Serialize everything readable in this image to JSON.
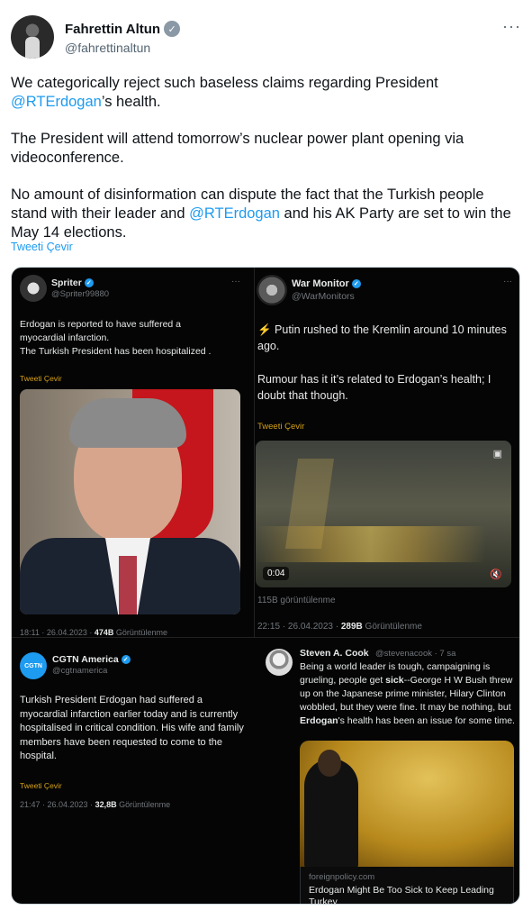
{
  "author": {
    "name": "Fahrettin Altun",
    "handle": "@fahrettinaltun",
    "more": "···"
  },
  "tweet": {
    "p1_a": "We categorically reject such baseless claims regarding President ",
    "p1_mention": "@RTErdogan",
    "p1_b": "’s health.",
    "p2": "The President will attend tomorrow’s nuclear power plant opening via videoconference.",
    "p3_a": "No amount of disinformation can dispute the fact that the Turkish people stand with their leader and ",
    "p3_mention": "@RTErdogan",
    "p3_b": " and his AK Party are set to win the May 14 elections.",
    "translate": "Tweeti Çevir"
  },
  "embedded": {
    "spriter": {
      "name": "Spriter",
      "handle": "@Spriter99880",
      "text": "Erdogan is reported to have suffered a myocardial infarction.\nThe Turkish President has been hospitalized .",
      "translate": "Tweeti Çevir",
      "meta_time": "18:11 · 26.04.2023 · ",
      "meta_views": "474B",
      "meta_label": " Görüntülenme"
    },
    "warmonitor": {
      "name": "War Monitor",
      "handle": "@WarMonitors",
      "text1": "⚡ Putin rushed to the Kremlin around 10 minutes ago.",
      "text2": "Rumour has it it’s related to Erdogan’s health; I doubt that though.",
      "translate": "Tweeti Çevir",
      "video_time": "0:04",
      "views": "115B görüntülenme",
      "meta_time": "22:15 · 26.04.2023 · ",
      "meta_views": "289B",
      "meta_label": " Görüntülenme"
    },
    "cgtn": {
      "name": "CGTN America",
      "handle": "@cgtnamerica",
      "avatar_text": "CGTN",
      "text": "Turkish President Erdogan had suffered a myocardial infarction earlier today and is currently hospitalised in critical condition. His wife and family members have been requested to come to the hospital.",
      "translate": "Tweeti Çevir",
      "meta_time": "21:47 · 26.04.2023 · ",
      "meta_views": "32,8B",
      "meta_label": " Görüntülenme"
    },
    "cook": {
      "name": "Steven A. Cook",
      "handle": "@stevenacook · 7 sa",
      "text_a": "Being a world leader is tough, campaigning is grueling, people get ",
      "text_sick": "sick",
      "text_b": "--George H W Bush threw up on the Japanese prime minister, Hilary Clinton wobbled, but they were fine. It may be nothing, but ",
      "text_erdogan": "Erdogan",
      "text_c": "'s health has been an issue for some time.",
      "link_domain": "foreignpolicy.com",
      "link_title": "Erdogan Might Be Too Sick to Keep Leading Turkey"
    }
  },
  "colors": {
    "accent": "#1d9bf0",
    "translate_gold": "#d4a017",
    "media_bg": "#050505"
  }
}
